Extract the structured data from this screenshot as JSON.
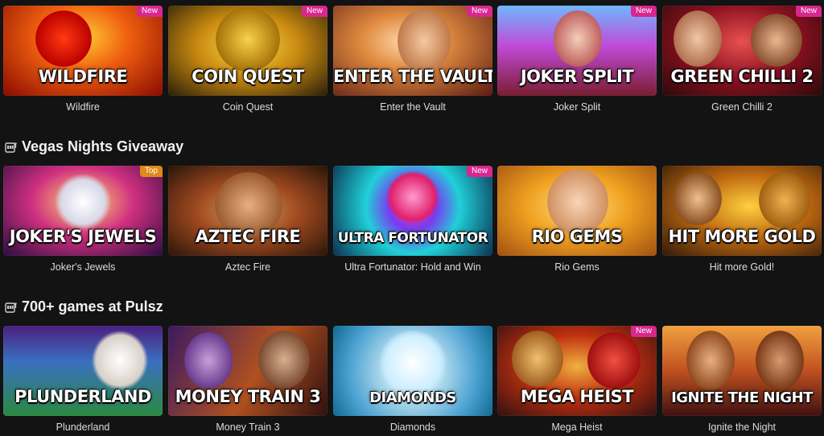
{
  "sections": [
    {
      "title": "",
      "games": [
        {
          "art_title": "WILDFIRE",
          "caption": "Wildfire",
          "badge": "New",
          "badge_kind": "new",
          "theme": "wildfire"
        },
        {
          "art_title": "COIN QUEST",
          "caption": "Coin Quest",
          "badge": "New",
          "badge_kind": "new",
          "theme": "coinquest"
        },
        {
          "art_title": "ENTER THE VAULT",
          "caption": "Enter the Vault",
          "badge": "New",
          "badge_kind": "new",
          "theme": "vault"
        },
        {
          "art_title": "JOKER SPLIT",
          "caption": "Joker Split",
          "badge": "New",
          "badge_kind": "new",
          "theme": "jokersplit"
        },
        {
          "art_title": "GREEN CHILLI 2",
          "caption": "Green Chilli 2",
          "badge": "New",
          "badge_kind": "new",
          "theme": "chilli"
        }
      ]
    },
    {
      "title": "Vegas Nights Giveaway",
      "games": [
        {
          "art_title": "JOKER'S JEWELS",
          "caption": "Joker's Jewels",
          "badge": "Top",
          "badge_kind": "top",
          "theme": "jewels"
        },
        {
          "art_title": "AZTEC FIRE",
          "caption": "Aztec Fire",
          "badge": "",
          "badge_kind": "",
          "theme": "aztec"
        },
        {
          "art_title": "ULTRA FORTUNATOR",
          "caption": "Ultra Fortunator: Hold and Win",
          "badge": "New",
          "badge_kind": "new",
          "theme": "ultra"
        },
        {
          "art_title": "RIO GEMS",
          "caption": "Rio Gems",
          "badge": "",
          "badge_kind": "",
          "theme": "rio"
        },
        {
          "art_title": "HIT MORE GOLD",
          "caption": "Hit more Gold!",
          "badge": "",
          "badge_kind": "",
          "theme": "hitgold"
        }
      ]
    },
    {
      "title": "700+ games at Pulsz",
      "games": [
        {
          "art_title": "PLUNDERLAND",
          "caption": "Plunderland",
          "badge": "",
          "badge_kind": "",
          "theme": "plunder"
        },
        {
          "art_title": "MONEY TRAIN 3",
          "caption": "Money Train 3",
          "badge": "",
          "badge_kind": "",
          "theme": "moneytrain"
        },
        {
          "art_title": "DIAMONDS",
          "caption": "Diamonds",
          "badge": "",
          "badge_kind": "",
          "theme": "diamonds"
        },
        {
          "art_title": "MEGA HEIST",
          "caption": "Mega Heist",
          "badge": "New",
          "badge_kind": "new",
          "theme": "megaheist"
        },
        {
          "art_title": "IGNITE THE NIGHT",
          "caption": "Ignite the Night",
          "badge": "",
          "badge_kind": "",
          "theme": "ignite"
        }
      ]
    }
  ]
}
